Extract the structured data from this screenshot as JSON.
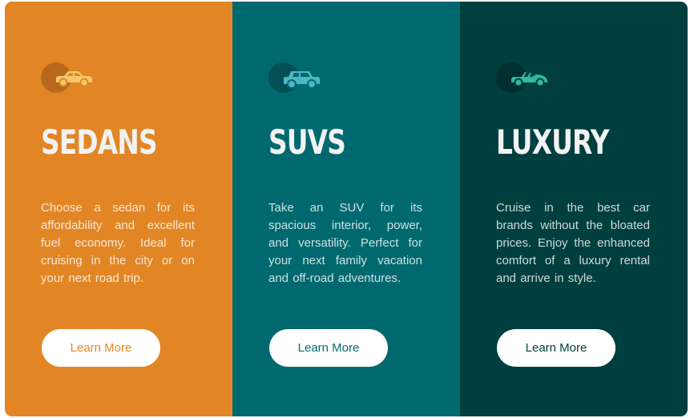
{
  "cards": [
    {
      "icon": "sedan-car-icon",
      "title": "SEDANS",
      "text": "Choose a sedan for its affordability and excellent fuel economy. Ideal for cruising in the city or on your next road trip.",
      "button": "Learn More"
    },
    {
      "icon": "suv-car-icon",
      "title": "SUVS",
      "text": "Take an SUV for its spacious interior, power, and versatility. Perfect for your next family vacation and off-road adventures.",
      "button": "Learn More"
    },
    {
      "icon": "luxury-car-icon",
      "title": "LUXURY",
      "text": "Cruise in the best car brands without the bloated prices. Enjoy the enhanced comfort of a luxury rental and arrive in style.",
      "button": "Learn More"
    }
  ],
  "colors": {
    "sedans_bg": "#e28625",
    "suvs_bg": "#006970",
    "luxury_bg": "#003f3f",
    "sedans_icon": "#f4c86a",
    "suvs_icon": "#4fb6c3",
    "luxury_icon": "#2fb8a4"
  }
}
